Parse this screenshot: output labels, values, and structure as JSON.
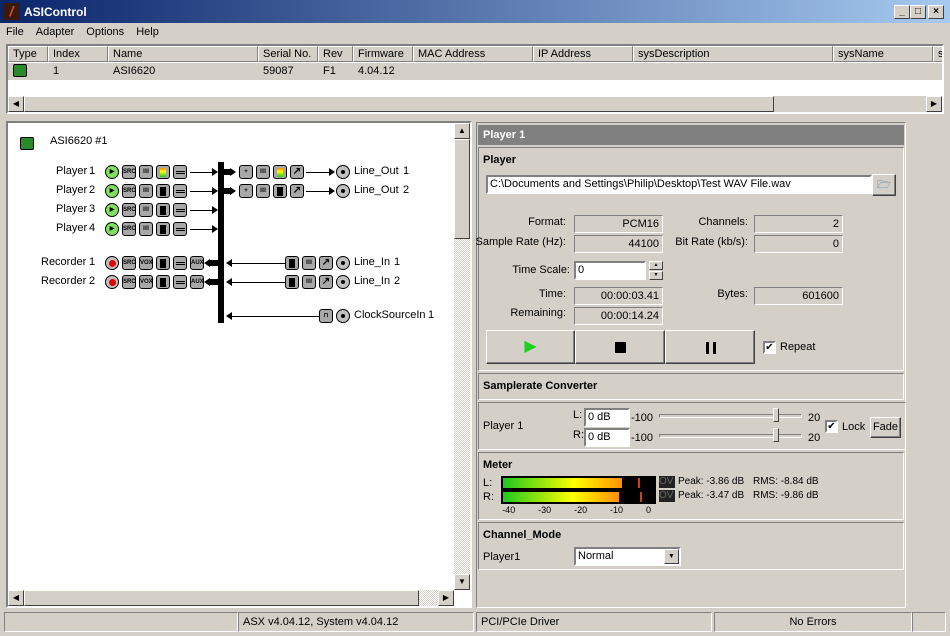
{
  "window": {
    "title": "ASIControl",
    "minimize": "_",
    "maximize": "□",
    "close": "×"
  },
  "menu": [
    "File",
    "Adapter",
    "Options",
    "Help"
  ],
  "adapter_list": {
    "columns": [
      "Type",
      "Index",
      "Name",
      "Serial No.",
      "Rev",
      "Firmware",
      "MAC Address",
      "IP Address",
      "sysDescription",
      "sysName",
      "s"
    ],
    "rows": [
      {
        "type_icon": "adapter-card-icon",
        "index": "1",
        "name": "ASI6620",
        "serial": "59087",
        "rev": "F1",
        "firmware": "4.04.12"
      }
    ]
  },
  "diagram": {
    "adapter_label": "ASI6620 #1",
    "players": [
      {
        "name": "Player",
        "num": "1",
        "meter_active": true
      },
      {
        "name": "Player",
        "num": "2",
        "meter_active": false
      },
      {
        "name": "Player",
        "num": "3",
        "meter_active": false
      },
      {
        "name": "Player",
        "num": "4",
        "meter_active": false
      }
    ],
    "recorders": [
      {
        "name": "Recorder",
        "num": "1"
      },
      {
        "name": "Recorder",
        "num": "2"
      }
    ],
    "line_outs": [
      {
        "name": "Line_Out",
        "num": "1",
        "meter_active": true
      },
      {
        "name": "Line_Out",
        "num": "2",
        "meter_active": false
      }
    ],
    "line_ins": [
      {
        "name": "Line_In",
        "num": "1"
      },
      {
        "name": "Line_In",
        "num": "2"
      }
    ],
    "clock": {
      "name": "ClockSourceIn",
      "num": "1"
    },
    "icon_labels": {
      "src": "SRC",
      "vox": "VOX",
      "aux": "AUX"
    }
  },
  "panel": {
    "header": "Player  1",
    "player": {
      "title": "Player",
      "file": "C:\\Documents and Settings\\Philip\\Desktop\\Test WAV File.wav",
      "format_label": "Format:",
      "format": "PCM16",
      "channels_label": "Channels:",
      "channels": "2",
      "sample_rate_label": "Sample Rate (Hz):",
      "sample_rate": "44100",
      "bit_rate_label": "Bit Rate (kb/s):",
      "bit_rate": "0",
      "time_scale_label": "Time Scale:",
      "time_scale": "0",
      "time_label": "Time:",
      "time": "00:00:03.41",
      "bytes_label": "Bytes:",
      "bytes": "601600",
      "remaining_label": "Remaining:",
      "remaining": "00:00:14.24",
      "repeat_label": "Repeat",
      "repeat": true
    },
    "src": {
      "title": "Samplerate Converter"
    },
    "gain": {
      "label": "Player  1",
      "l_label": "L:",
      "r_label": "R:",
      "l_value": "0 dB",
      "r_value": "0 dB",
      "min": "-100",
      "max": "20",
      "lock_label": "Lock",
      "lock": true,
      "fade_label": "Fade",
      "l_db": 0,
      "r_db": 0
    },
    "meter": {
      "title": "Meter",
      "l_label": "L:",
      "r_label": "R:",
      "ov": "OV",
      "l_peak": "Peak: -3.86 dB",
      "l_rms": "RMS: -8.84 dB",
      "r_peak": "Peak: -3.47 dB",
      "r_rms": "RMS: -9.86 dB",
      "l_rms_db": -8.84,
      "r_rms_db": -9.86,
      "l_peak_db": -3.86,
      "r_peak_db": -3.47,
      "scale": [
        "-40",
        "-30",
        "-20",
        "-10",
        "0"
      ]
    },
    "channel_mode": {
      "title": "Channel_Mode",
      "label": "Player1",
      "value": "Normal"
    }
  },
  "status": {
    "version": "ASX v4.04.12, System v4.04.12",
    "driver": "PCI/PCIe Driver",
    "errors": "No Errors"
  }
}
